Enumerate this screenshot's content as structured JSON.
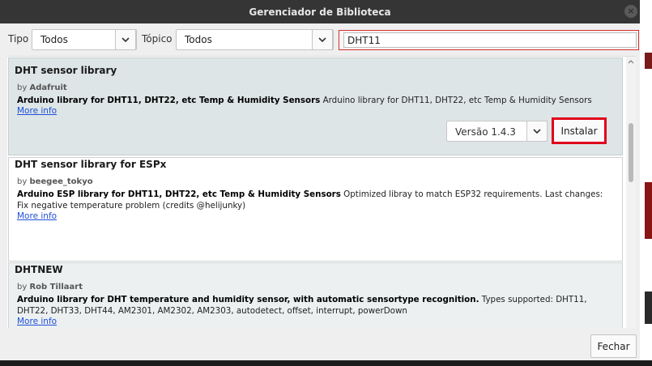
{
  "window": {
    "title": "Gerenciador de Biblioteca",
    "close_glyph": "×"
  },
  "filters": {
    "type_label": "Tipo",
    "type_value": "Todos",
    "topic_label": "Tópico",
    "topic_value": "Todos",
    "search_value": "DHT11"
  },
  "libraries": [
    {
      "name": "DHT sensor library",
      "by_prefix": "by",
      "author": "Adafruit",
      "summary": "Arduino library for DHT11, DHT22, etc Temp & Humidity Sensors",
      "description": "Arduino library for DHT11, DHT22, etc Temp & Humidity Sensors",
      "more_info": "More info",
      "version": "Versão 1.4.3",
      "install_label": "Instalar"
    },
    {
      "name": "DHT sensor library for ESPx",
      "by_prefix": "by",
      "author": "beegee_tokyo",
      "summary": "Arduino ESP library for DHT11, DHT22, etc Temp & Humidity Sensors",
      "description": "Optimized libray to match ESP32 requirements. Last changes: Fix negative temperature problem (credits @helijunky)",
      "more_info": "More info"
    },
    {
      "name": "DHTNEW",
      "by_prefix": "by",
      "author": "Rob Tillaart",
      "summary": "Arduino library for DHT temperature and humidity sensor, with automatic sensortype recognition.",
      "description": "Types supported: DHT11, DHT22, DHT33, DHT44, AM2301, AM2302, AM2303, autodetect, offset, interrupt, powerDown",
      "more_info": "More info"
    }
  ],
  "footer": {
    "close_label": "Fechar"
  },
  "colors": {
    "highlight": "#e0001b",
    "link": "#1f4fd8",
    "titlebar": "#353535"
  },
  "icons": [
    "close-icon",
    "chevron-down-icon",
    "scroll-up-icon"
  ]
}
